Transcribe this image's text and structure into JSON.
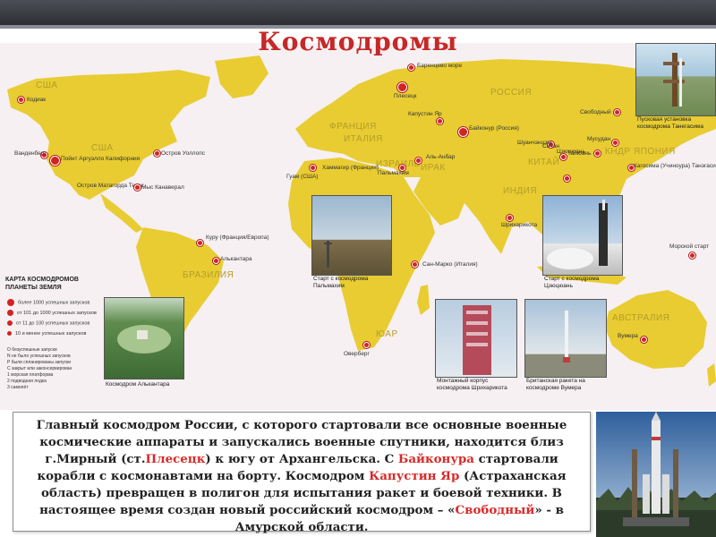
{
  "slide": {
    "title": "Космодромы"
  },
  "map": {
    "countries": {
      "usa_alaska": "США",
      "usa": "США",
      "russia": "РОССИЯ",
      "china": "КИТАЙ",
      "india": "ИНДИЯ",
      "brazil": "БРАЗИЛИЯ",
      "australia": "АВСТРАЛИЯ",
      "france": "ФРАНЦИЯ",
      "italy": "ИТАЛИЯ",
      "israel": "ИЗРАИЛЬ",
      "iraq": "ИРАК",
      "japan": "ЯПОНИЯ",
      "korea": "КНДР",
      "sar": "ЮАР"
    },
    "sites": {
      "kodiak": "Кодиак",
      "vandenberg": "Ванденберг",
      "point_arguello": "Пойнт Аргуэлло\nКалифорния",
      "wallops": "Остров Уоллопс",
      "matagorda": "Остров Матагорда\nТехас",
      "canaveral": "Мыс Канаверал",
      "barents": "Баренцево море",
      "plesetsk": "Плесецк",
      "kapustin": "Капустин Яр",
      "baikonur": "Байконур\n(Россия)",
      "svobodny": "Свободный",
      "hammaguir": "Хаммагир\n(Франция)",
      "palmachim": "Пальмахим",
      "anbar": "Аль-Анбар",
      "shuangchengzi": "Шуанчэнцзы",
      "jiuquan": "Цзюцюань",
      "taiyuan": "Тайюань",
      "xichang": "Сичан",
      "musudan": "Мусудан",
      "kagoshima": "Кагосима (Учиноура)\nТанэгасима",
      "sriharikota": "Шрихарикота",
      "kourou": "Куру\n(Франция/Европа)",
      "alcantara": "Алькантара",
      "san_marco": "Сан-Марко\n(Италия)",
      "overberg": "Оверберг",
      "woomera": "Вумера",
      "sea_launch": "Морской\nстарт",
      "guam": "Гуам (США)"
    },
    "legend": {
      "title": "КАРТА КОСМОДРОМОВ\nПЛАНЕТЫ ЗЕМЛЯ",
      "rows": [
        "более 1000 успешных запусков",
        "от 101 до 1000 успешных запусков",
        "от 11 до 100 успешных запусков",
        "10 и менее успешных запусков"
      ],
      "codes": [
        "О  безуспешные запуски",
        "N  не было успешных запусков",
        "P  были спланированы запуски",
        "C  закрыт или законсервирован",
        "1  морская платформа",
        "2  подводная лодка",
        "3  самолёт"
      ]
    },
    "photo_captions": {
      "tanegashima": "Пусковая установка\nкосмодрома Танегасима",
      "palmachim": "Старт с космодрома\nПальмахим",
      "jiuquan": "Старт с космодрома\nЦзюцюань",
      "alcantara": "Космодром Алькантара",
      "sriharikota": "Монтажный корпус\nкосмодрома Шрихарикота",
      "woomera": "Британская ракета на\nкосмодроме Вумера"
    }
  },
  "body_text": {
    "p1": "Главный космодром России, с которого стартовали все основные военные космические аппараты и запускались военные спутники, находится близ г.Мирный (ст.",
    "plesetsk": "Плесецк",
    "p2": ") к югу от Архангельска. С ",
    "baikonur": "Байконура",
    "p3": " стартовали корабли с космонавтами на борту.  Космодром ",
    "kapustin": "Капустин Яр",
    "p4": " (Астраханская область) превращен в полигон для испытания ракет и боевой техники.  В настоящее время создан новый российский космодром – «",
    "svobodny": "Свободный",
    "p5": "» - в Амурской области."
  },
  "colors": {
    "title": "#c62828",
    "land": "#e8cc32",
    "ocean": "#f6f0f2",
    "highlight": "#d62a2a",
    "site_dot": "#d32222"
  }
}
